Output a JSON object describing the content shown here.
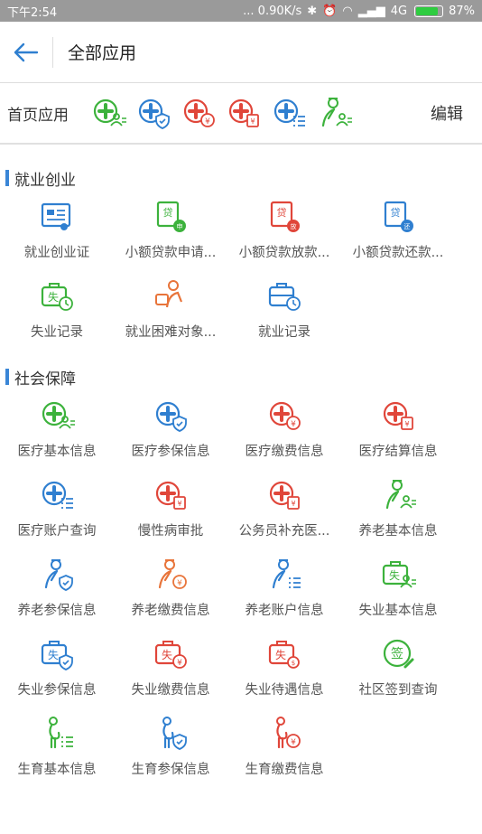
{
  "status": {
    "time": "下午2:54",
    "network": "... 0.90K/s",
    "carrier": "4G",
    "battery": "87%"
  },
  "header": {
    "title": "全部应用"
  },
  "home_apps": {
    "label": "首页应用",
    "edit": "编辑"
  },
  "sections": [
    {
      "title": "就业创业",
      "items": [
        {
          "label": "就业创业证",
          "icon": "employment-cert-icon"
        },
        {
          "label": "小额贷款申请...",
          "icon": "loan-apply-icon"
        },
        {
          "label": "小额贷款放款...",
          "icon": "loan-release-icon"
        },
        {
          "label": "小额贷款还款...",
          "icon": "loan-repay-icon"
        },
        {
          "label": "失业记录",
          "icon": "unemployment-record-icon"
        },
        {
          "label": "就业困难对象...",
          "icon": "hardship-person-icon"
        },
        {
          "label": "就业记录",
          "icon": "employment-record-icon"
        }
      ]
    },
    {
      "title": "社会保障",
      "items": [
        {
          "label": "医疗基本信息",
          "icon": "medical-basic-icon"
        },
        {
          "label": "医疗参保信息",
          "icon": "medical-insured-icon"
        },
        {
          "label": "医疗缴费信息",
          "icon": "medical-payment-icon"
        },
        {
          "label": "医疗结算信息",
          "icon": "medical-settlement-icon"
        },
        {
          "label": "医疗账户查询",
          "icon": "medical-account-icon"
        },
        {
          "label": "慢性病审批",
          "icon": "chronic-approval-icon"
        },
        {
          "label": "公务员补充医...",
          "icon": "civil-servant-medical-icon"
        },
        {
          "label": "养老基本信息",
          "icon": "pension-basic-icon"
        },
        {
          "label": "养老参保信息",
          "icon": "pension-insured-icon"
        },
        {
          "label": "养老缴费信息",
          "icon": "pension-payment-icon"
        },
        {
          "label": "养老账户信息",
          "icon": "pension-account-icon"
        },
        {
          "label": "失业基本信息",
          "icon": "unemployment-basic-icon"
        },
        {
          "label": "失业参保信息",
          "icon": "unemployment-insured-icon"
        },
        {
          "label": "失业缴费信息",
          "icon": "unemployment-payment-icon"
        },
        {
          "label": "失业待遇信息",
          "icon": "unemployment-benefit-icon"
        },
        {
          "label": "社区签到查询",
          "icon": "community-checkin-icon"
        },
        {
          "label": "生育基本信息",
          "icon": "maternity-basic-icon"
        },
        {
          "label": "生育参保信息",
          "icon": "maternity-insured-icon"
        },
        {
          "label": "生育缴费信息",
          "icon": "maternity-payment-icon"
        }
      ]
    }
  ],
  "colors": {
    "green": "#3cb23c",
    "blue": "#2f7fd0",
    "red": "#e0463a",
    "orange": "#e8743a"
  }
}
